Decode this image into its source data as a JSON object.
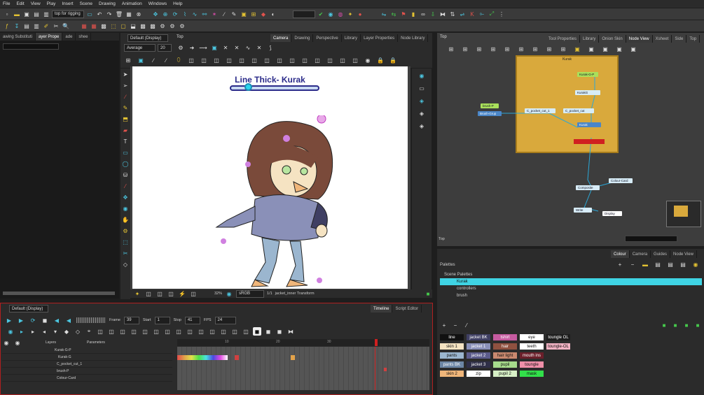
{
  "menu": [
    "File",
    "Edit",
    "View",
    "Play",
    "Insert",
    "Scene",
    "Drawing",
    "Animation",
    "Windows",
    "Help"
  ],
  "toolbar": {
    "workspace": "top for rigging",
    "mode_search": ""
  },
  "left_panel": {
    "tabs": [
      "awing Substituti",
      "ayer Prope",
      "ade",
      "shee"
    ]
  },
  "camera_view": {
    "view_combo": "Default (Display)",
    "breadcrumb": "Top",
    "tabs": [
      "Camera",
      "Drawing",
      "Perspective",
      "Library",
      "Layer Properties",
      "Node Library"
    ],
    "brush_mode": "Average",
    "brush_size": "20",
    "title": "Line Thick- Kurak",
    "zoom": "32%",
    "colorspace": "sRGB",
    "status": "1/1",
    "status2": "jacket_inner Transform"
  },
  "node_view": {
    "breadcrumb": "Top",
    "tabs": [
      "Tool Properties",
      "Library",
      "Onion Skin",
      "Node View",
      "Xsheet",
      "Side",
      "Top"
    ],
    "group": "Kurak",
    "nodes": [
      "Kurak-G-P",
      "KurakG",
      "C_pocket_cut_1",
      "C_pocket_cut",
      "Kurak",
      "brush-P",
      "Brush-Grup",
      "Composite",
      "Colour-Card",
      "Write",
      "Display"
    ],
    "search": ""
  },
  "palettes": {
    "tabs": [
      "Colour",
      "Camera",
      "Guides",
      "Node View"
    ],
    "header": "Palettes",
    "tree": [
      "Scene Palettes",
      "Kurak",
      "controllers",
      "brush"
    ],
    "swatches": [
      [
        {
          "n": "line",
          "c": "#111111",
          "t": "#fff"
        },
        {
          "n": "jacket BK",
          "c": "#3f3f63",
          "t": "#fff"
        },
        {
          "n": "tshirt",
          "c": "#c65ba0",
          "t": "#fff"
        },
        {
          "n": "eye",
          "c": "#ffffff",
          "t": "#111"
        },
        {
          "n": "toungle OL",
          "c": "#1e1e1e",
          "t": "#fff"
        }
      ],
      [
        {
          "n": "skin 1",
          "c": "#f5e3c2",
          "t": "#111"
        },
        {
          "n": "jacket 1",
          "c": "#8a90b8",
          "t": "#fff"
        },
        {
          "n": "hair",
          "c": "#8f5140",
          "t": "#fff"
        },
        {
          "n": "teeth",
          "c": "#ffffff",
          "t": "#111"
        },
        {
          "n": "toungle-OL",
          "c": "#f2b3c4",
          "t": "#111"
        }
      ],
      [
        {
          "n": "pants",
          "c": "#9bb6cf",
          "t": "#111"
        },
        {
          "n": "jacket 2",
          "c": "#5c5c8c",
          "t": "#fff"
        },
        {
          "n": "hair light",
          "c": "#c9896f",
          "t": "#111"
        },
        {
          "n": "mouth ins",
          "c": "#6b1f2a",
          "t": "#fff"
        }
      ],
      [
        {
          "n": "pants BK",
          "c": "#6d87a6",
          "t": "#fff"
        },
        {
          "n": "jacket 3",
          "c": "#2f2f48",
          "t": "#fff"
        },
        {
          "n": "pupil",
          "c": "#a7dc8c",
          "t": "#111"
        },
        {
          "n": "toungle",
          "c": "#f08fa9",
          "t": "#111"
        }
      ],
      [
        {
          "n": "skin 2",
          "c": "#f0b67a",
          "t": "#111"
        },
        {
          "n": "zip",
          "c": "#ffffff",
          "t": "#111"
        },
        {
          "n": "pupil 2",
          "c": "#d7f0c6",
          "t": "#111"
        },
        {
          "n": "mask",
          "c": "#32e04a",
          "t": "#111"
        }
      ]
    ]
  },
  "timeline": {
    "view": "Default (Display)",
    "tabs": [
      "Timeline",
      "Script Editor"
    ],
    "frame_label": "Frame",
    "frame": "39",
    "start_label": "Start",
    "start": "1",
    "stop_label": "Stop",
    "stop": "41",
    "fps_label": "FPS",
    "fps": "24",
    "layers_header": "Layers",
    "params_header": "Parameters",
    "layers": [
      "Kurak-G-P",
      "Kurak-G",
      "C_pocket_cut_1",
      "brush-P",
      "Colour-Card"
    ],
    "ruler": [
      "10",
      "20",
      "30"
    ]
  }
}
